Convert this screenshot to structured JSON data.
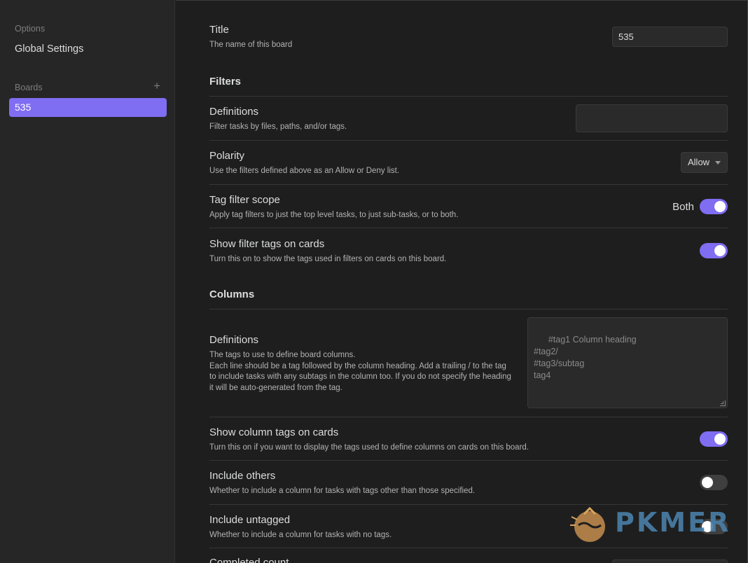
{
  "sidebar": {
    "options_label": "Options",
    "global_settings": "Global Settings",
    "boards_label": "Boards",
    "add_icon": "+",
    "active_board": "535"
  },
  "title_setting": {
    "name": "Title",
    "desc": "The name of this board",
    "value": "535"
  },
  "filters": {
    "heading": "Filters",
    "definitions": {
      "name": "Definitions",
      "desc": "Filter tasks by files, paths, and/or tags.",
      "value": ""
    },
    "polarity": {
      "name": "Polarity",
      "desc": "Use the filters defined above as an Allow or Deny list.",
      "selected": "Allow"
    },
    "tag_scope": {
      "name": "Tag filter scope",
      "desc": "Apply tag filters to just the top level tasks, to just sub-tasks, or to both.",
      "toggle_label": "Both"
    },
    "show_tags": {
      "name": "Show filter tags on cards",
      "desc": "Turn this on to show the tags used in filters on cards on this board."
    }
  },
  "columns": {
    "heading": "Columns",
    "definitions": {
      "name": "Definitions",
      "desc_line1": "The tags to use to define board columns.",
      "desc_line2": "Each line should be a tag followed by the column heading. Add a trailing / to the tag to include tasks with any subtags in the column too. If you do not specify the heading it will be auto-generated from the tag.",
      "placeholder": "#tag1 Column heading\n#tag2/\n#tag3/subtag\ntag4"
    },
    "show_tags": {
      "name": "Show column tags on cards",
      "desc": "Turn this on if you want to display the tags used to define columns on cards on this board."
    },
    "include_others": {
      "name": "Include others",
      "desc": "Whether to include a column for tasks with tags other than those specified."
    },
    "include_untagged": {
      "name": "Include untagged",
      "desc": "Whether to include a column for tasks with no tags."
    },
    "completed_count": {
      "name": "Completed count"
    }
  },
  "watermark": {
    "text": "PKMER"
  }
}
